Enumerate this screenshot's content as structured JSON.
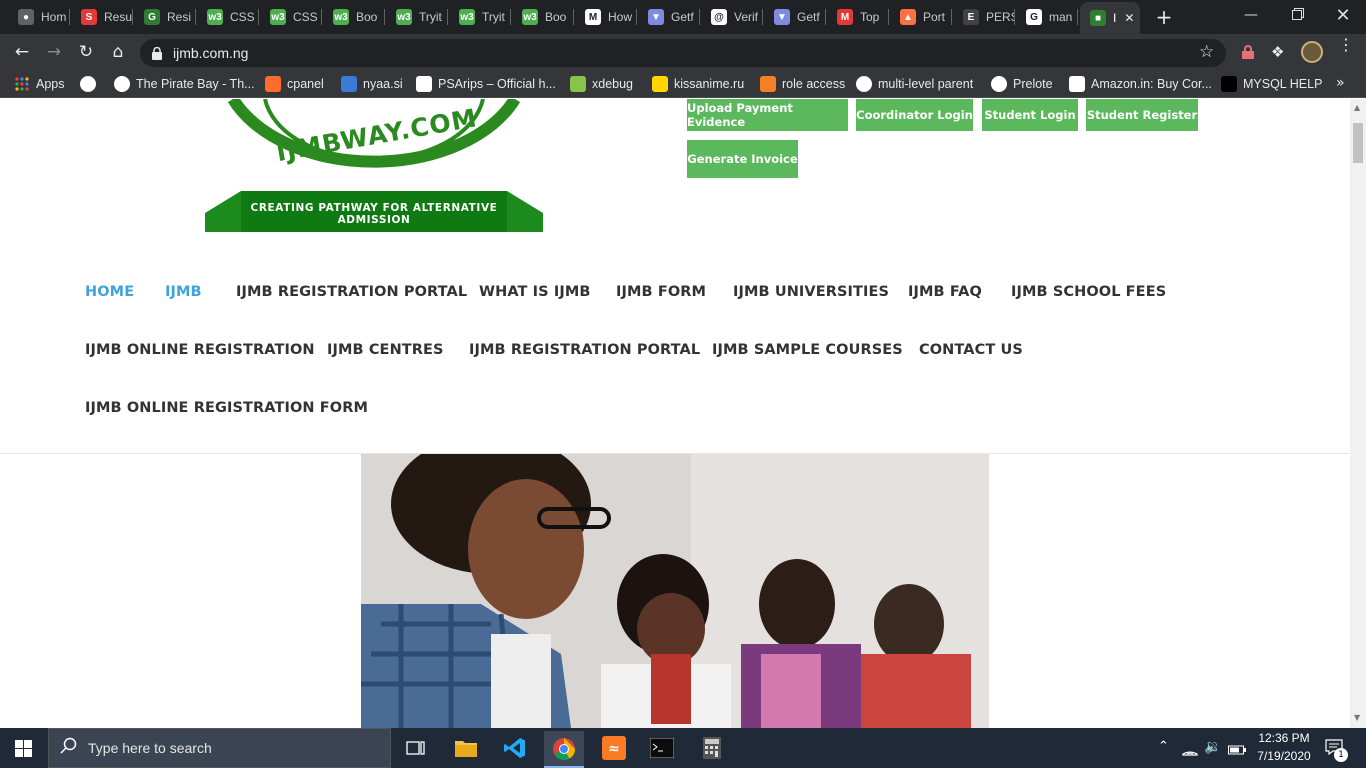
{
  "browser": {
    "tabs": [
      {
        "title": "Hom",
        "icon": "globe-icon",
        "color": "#5f6368"
      },
      {
        "title": "Resu",
        "icon": "s-icon",
        "color": "#e53935"
      },
      {
        "title": "Resi",
        "icon": "gfg-icon",
        "color": "#2e7d32"
      },
      {
        "title": "CSS",
        "icon": "w3-icon",
        "color": "#4caf50"
      },
      {
        "title": "CSS",
        "icon": "w3-icon",
        "color": "#4caf50"
      },
      {
        "title": "Boo",
        "icon": "w3-icon",
        "color": "#4caf50"
      },
      {
        "title": "Tryit",
        "icon": "w3-icon",
        "color": "#4caf50"
      },
      {
        "title": "Tryit",
        "icon": "w3-icon",
        "color": "#4caf50"
      },
      {
        "title": "Boo",
        "icon": "w3-icon",
        "color": "#4caf50"
      },
      {
        "title": "How",
        "icon": "medium-icon",
        "color": "#ffffff"
      },
      {
        "title": "Getf",
        "icon": "shield-icon",
        "color": "#7e8ce0"
      },
      {
        "title": "Verif",
        "icon": "mail-icon",
        "color": "#ffffff"
      },
      {
        "title": "Getf",
        "icon": "shield-icon",
        "color": "#7e8ce0"
      },
      {
        "title": "Top",
        "icon": "gmail-icon",
        "color": "#e53935"
      },
      {
        "title": "Port",
        "icon": "fire-icon",
        "color": "#ff7043"
      },
      {
        "title": "PERS",
        "icon": "e-icon",
        "color": "#424242"
      },
      {
        "title": "man",
        "icon": "google-icon",
        "color": "#ffffff"
      },
      {
        "title": "I",
        "icon": "ijmb-icon",
        "color": "#2e7d32"
      }
    ],
    "url": "ijmb.com.ng",
    "bookmarks": [
      {
        "label": "Apps",
        "icon": "apps-icon"
      },
      {
        "label": "",
        "icon": "google-icon"
      },
      {
        "label": "The Pirate Bay - Th...",
        "icon": "pirate-icon"
      },
      {
        "label": "cpanel",
        "icon": "cpanel-icon"
      },
      {
        "label": "nyaa.si",
        "icon": "nyaa-icon"
      },
      {
        "label": "PSArips – Official h...",
        "icon": "psa-icon"
      },
      {
        "label": "xdebug",
        "icon": "xdebug-icon"
      },
      {
        "label": "kissanime.ru",
        "icon": "kiss-icon"
      },
      {
        "label": "role access",
        "icon": "stack-icon"
      },
      {
        "label": "multi-level parent",
        "icon": "google-icon"
      },
      {
        "label": "Prelote",
        "icon": "globe-icon"
      },
      {
        "label": "Amazon.in: Buy Cor...",
        "icon": "amazon-icon"
      },
      {
        "label": "MYSQL HELP",
        "icon": "mysql-icon"
      }
    ]
  },
  "site": {
    "logo_url_text": "IJMBWAY.COM",
    "logo_tagline_1": "CREATING PATHWAY FOR ALTERNATIVE",
    "logo_tagline_2": "ADMISSION",
    "buttons": [
      "Upload Payment Evidence",
      "Coordinator Login",
      "Student Login",
      "Student Register",
      "Generate Invoice"
    ],
    "nav": [
      "HOME",
      "IJMB",
      "IJMB REGISTRATION PORTAL",
      "WHAT IS IJMB",
      "IJMB FORM",
      "IJMB UNIVERSITIES",
      "IJMB FAQ",
      "IJMB SCHOOL FEES",
      "IJMB ONLINE REGISTRATION",
      "IJMB CENTRES",
      "IJMB REGISTRATION PORTAL",
      "IJMB SAMPLE COURSES",
      "CONTACT US",
      "IJMB ONLINE REGISTRATION FORM"
    ],
    "accent_color": "#5cb85c",
    "nav_active_color": "#3fa4dc"
  },
  "taskbar": {
    "search_placeholder": "Type here to search",
    "time": "12:36 PM",
    "date": "7/19/2020",
    "notification_count": "1"
  }
}
